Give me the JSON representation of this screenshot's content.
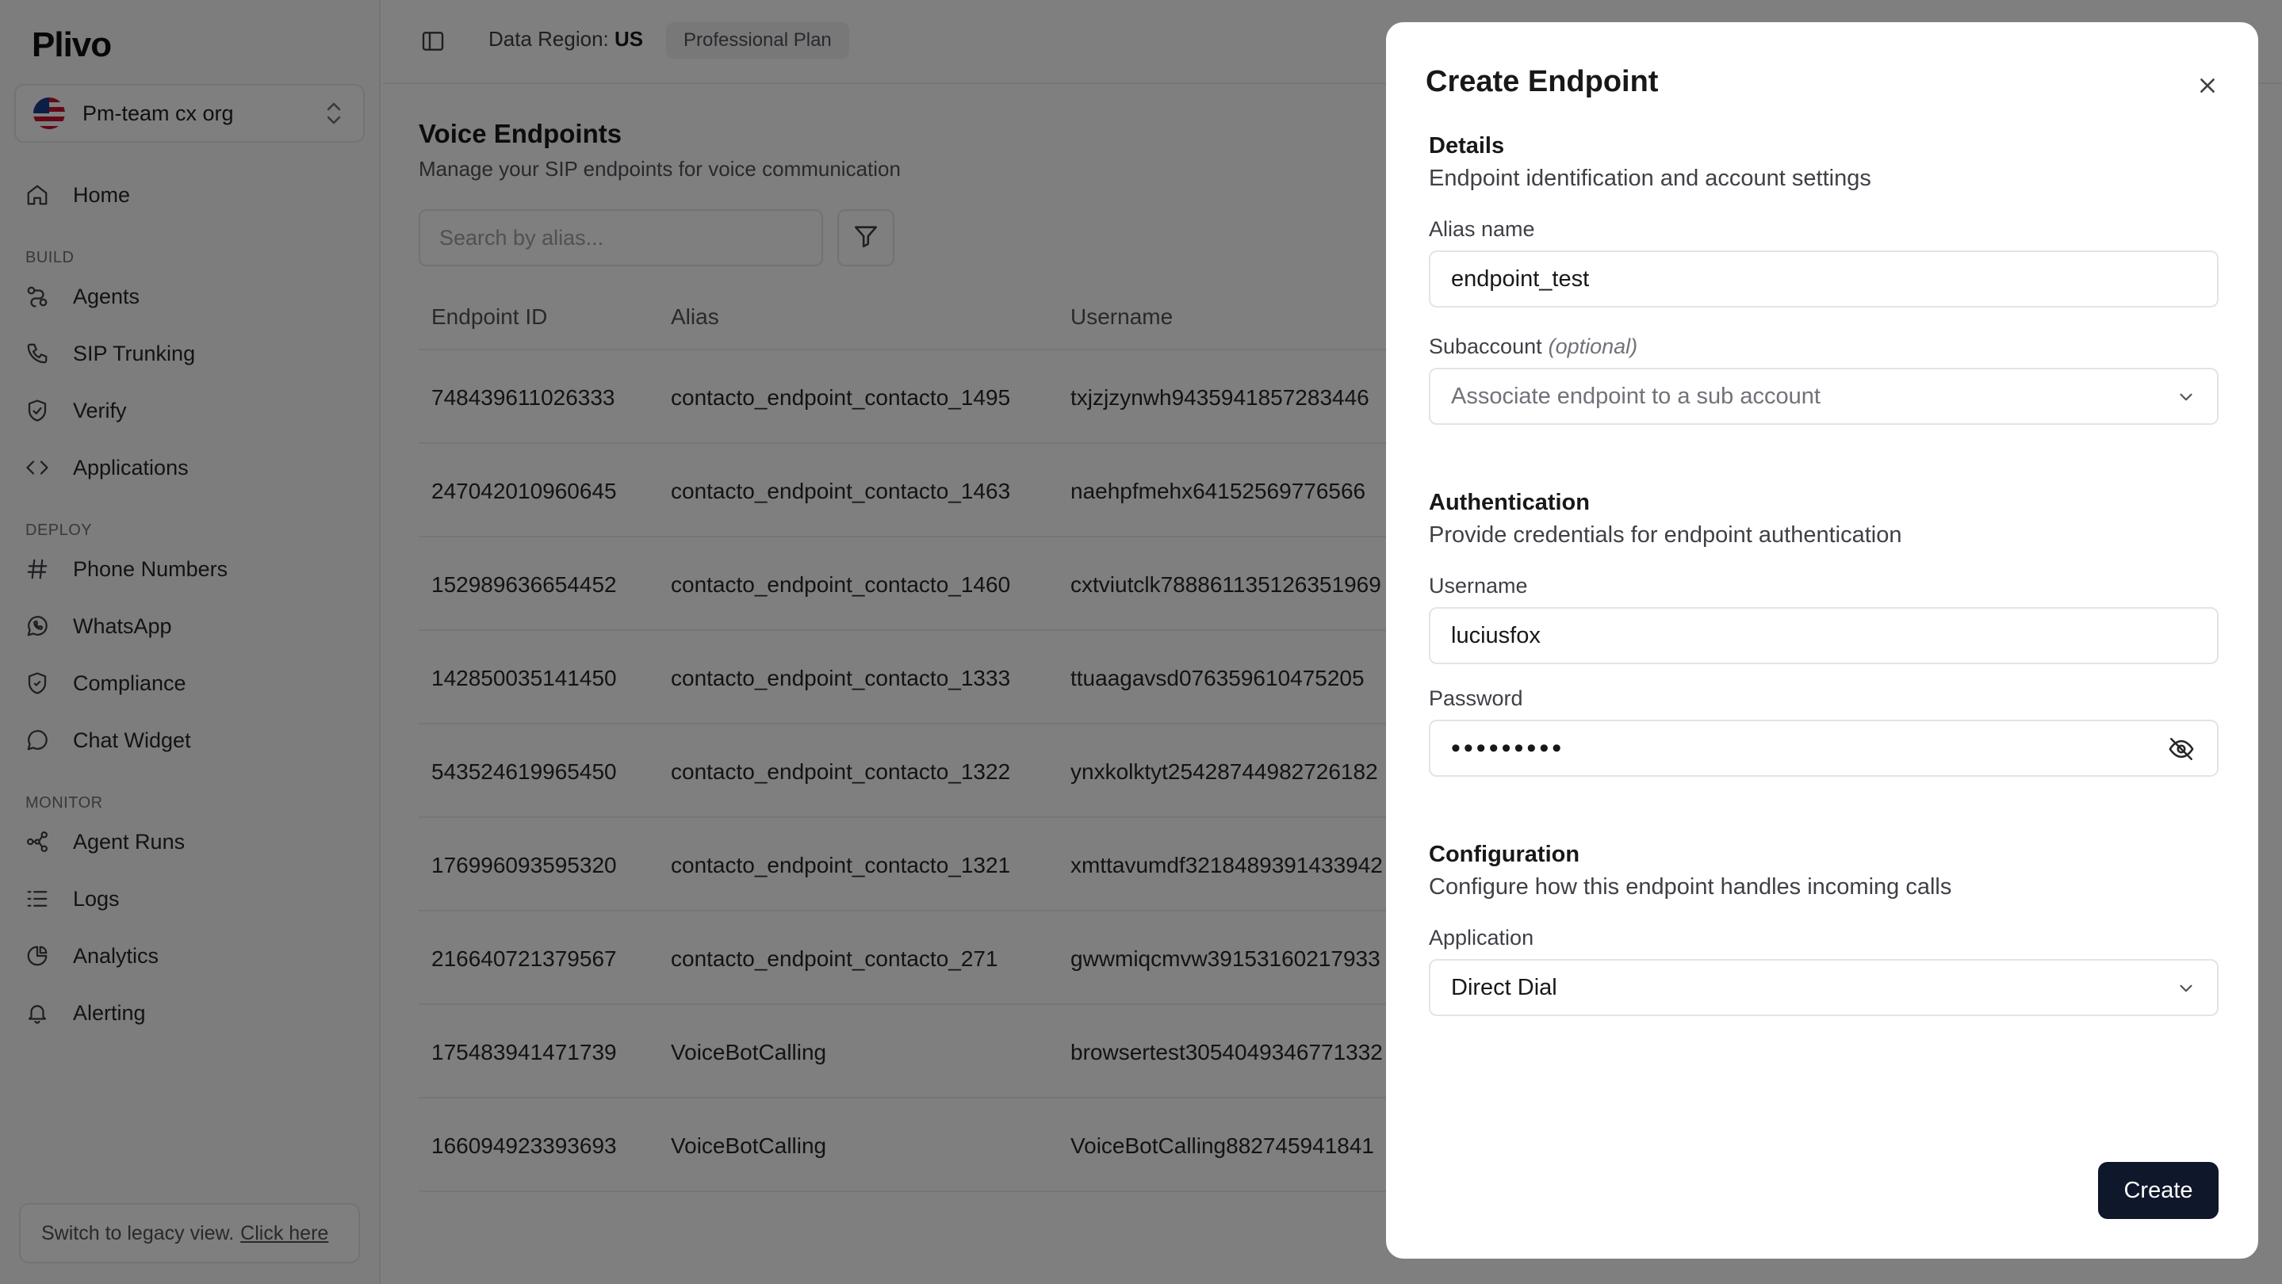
{
  "app": {
    "logo": "Plivo"
  },
  "org": {
    "name": "Pm-team cx org"
  },
  "sidebar": {
    "items": [
      {
        "label": "Home"
      },
      {
        "label": "Agents"
      },
      {
        "label": "SIP Trunking"
      },
      {
        "label": "Verify"
      },
      {
        "label": "Applications"
      },
      {
        "label": "Phone Numbers"
      },
      {
        "label": "WhatsApp"
      },
      {
        "label": "Compliance"
      },
      {
        "label": "Chat Widget"
      },
      {
        "label": "Agent Runs"
      },
      {
        "label": "Logs"
      },
      {
        "label": "Analytics"
      },
      {
        "label": "Alerting"
      }
    ],
    "sections": {
      "build": "BUILD",
      "deploy": "DEPLOY",
      "monitor": "MONITOR"
    },
    "legacy": {
      "text": "Switch to legacy view.",
      "link": "Click here"
    }
  },
  "topbar": {
    "region_label": "Data Region:",
    "region_value": "US",
    "plan": "Professional Plan"
  },
  "page": {
    "title": "Voice Endpoints",
    "subtitle": "Manage your SIP endpoints for voice communication",
    "search_placeholder": "Search by alias..."
  },
  "table": {
    "headers": [
      "Endpoint ID",
      "Alias",
      "Username"
    ],
    "rows": [
      [
        "748439611026333",
        "contacto_endpoint_contacto_1495",
        "txjzjzynwh9435941857283446"
      ],
      [
        "247042010960645",
        "contacto_endpoint_contacto_1463",
        "naehpfmehx64152569776566"
      ],
      [
        "152989636654452",
        "contacto_endpoint_contacto_1460",
        "cxtviutclk788861135126351969"
      ],
      [
        "142850035141450",
        "contacto_endpoint_contacto_1333",
        "ttuaagavsd076359610475205"
      ],
      [
        "543524619965450",
        "contacto_endpoint_contacto_1322",
        "ynxkolktyt25428744982726182"
      ],
      [
        "176996093595320",
        "contacto_endpoint_contacto_1321",
        "xmttavumdf3218489391433942"
      ],
      [
        "216640721379567",
        "contacto_endpoint_contacto_271",
        "gwwmiqcmvw39153160217933"
      ],
      [
        "175483941471739",
        "VoiceBotCalling",
        "browsertest3054049346771332"
      ],
      [
        "166094923393693",
        "VoiceBotCalling",
        "VoiceBotCalling882745941841"
      ]
    ]
  },
  "modal": {
    "title": "Create Endpoint",
    "details": {
      "heading": "Details",
      "desc": "Endpoint identification and account settings"
    },
    "alias": {
      "label": "Alias name",
      "value": "endpoint_test"
    },
    "subaccount": {
      "label": "Subaccount",
      "optional": "(optional)",
      "placeholder": "Associate endpoint to a sub account"
    },
    "auth": {
      "heading": "Authentication",
      "desc": "Provide credentials for endpoint authentication"
    },
    "username": {
      "label": "Username",
      "value": "luciusfox"
    },
    "password": {
      "label": "Password",
      "masked": "•••••••••"
    },
    "config": {
      "heading": "Configuration",
      "desc": "Configure how this endpoint handles incoming calls"
    },
    "application": {
      "label": "Application",
      "value": "Direct Dial"
    },
    "create_label": "Create"
  },
  "colors": {
    "primary_button": "#0f172a",
    "overlay": "rgba(0,0,0,0.5)"
  }
}
